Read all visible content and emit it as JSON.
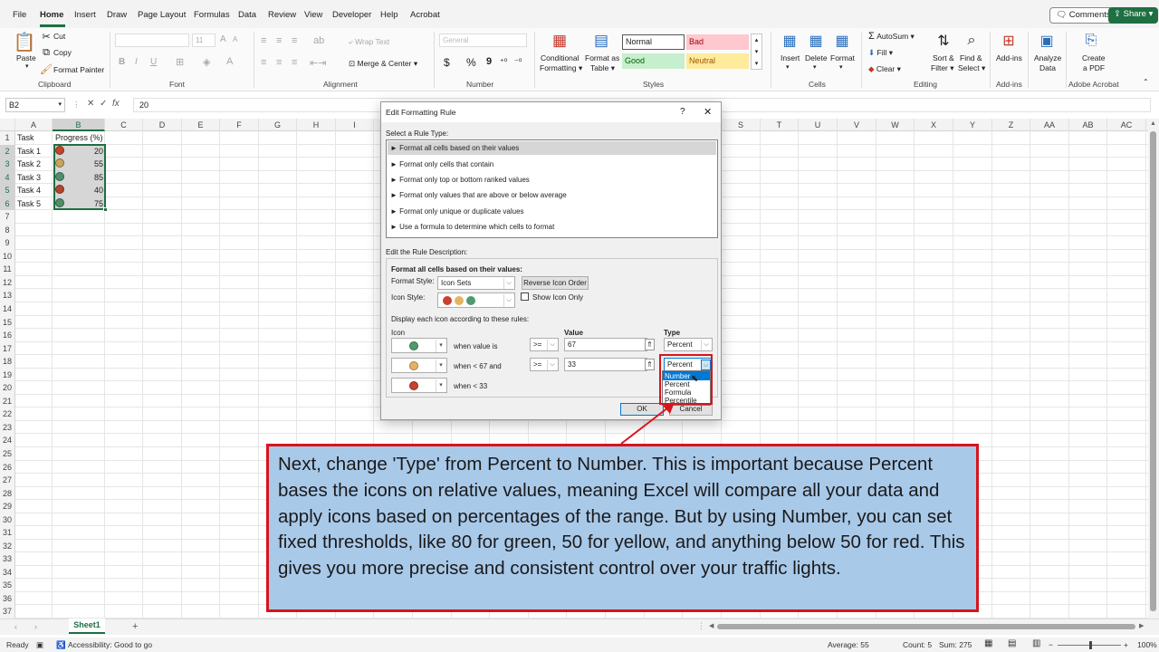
{
  "tabs": [
    "File",
    "Home",
    "Insert",
    "Draw",
    "Page Layout",
    "Formulas",
    "Data",
    "Review",
    "View",
    "Developer",
    "Help",
    "Acrobat"
  ],
  "top_buttons": {
    "comments": "Comments",
    "share": "Share"
  },
  "ribbon": {
    "clipboard": {
      "paste": "Paste",
      "cut": "Cut",
      "copy": "Copy",
      "format_painter": "Format Painter",
      "group": "Clipboard"
    },
    "font": {
      "font_name": "",
      "font_size": "11",
      "bold": "B",
      "italic": "I",
      "underline": "U",
      "group": "Font"
    },
    "alignment": {
      "wrap_text": "Wrap Text",
      "merge_center": "Merge & Center",
      "group": "Alignment"
    },
    "number": {
      "format": "General",
      "currency": "$",
      "percent": "%",
      "comma": "9",
      "group": "Number"
    },
    "styles": {
      "conditional": "Conditional",
      "formatting": "Formatting",
      "format_as": "Format as",
      "table": "Table",
      "normal": "Normal",
      "bad": "Bad",
      "good": "Good",
      "neutral": "Neutral",
      "group": "Styles"
    },
    "cells": {
      "insert": "Insert",
      "delete": "Delete",
      "format": "Format",
      "group": "Cells"
    },
    "editing": {
      "autosum": "AutoSum",
      "fill": "Fill",
      "clear": "Clear",
      "sort_filter": "Sort &",
      "filter": "Filter",
      "find_select": "Find &",
      "select": "Select",
      "group": "Editing"
    },
    "addins": {
      "addins": "Add-ins",
      "group": "Add-ins"
    },
    "analyze": {
      "l1": "Analyze",
      "l2": "Data"
    },
    "acrobat": {
      "l1": "Create",
      "l2": "a PDF",
      "group": "Adobe Acrobat"
    }
  },
  "formula_bar": {
    "name_box": "B2",
    "fx": "fx",
    "value": "20"
  },
  "columns": [
    "A",
    "B",
    "C",
    "D",
    "E",
    "F",
    "G",
    "H",
    "I",
    "J",
    "K",
    "L",
    "M",
    "N",
    "O",
    "P",
    "Q",
    "R",
    "S",
    "T",
    "U",
    "V",
    "W",
    "X",
    "Y",
    "Z",
    "AA",
    "AB",
    "AC"
  ],
  "rows": [
    "1",
    "2",
    "3",
    "4",
    "5",
    "6",
    "7",
    "8",
    "9",
    "10",
    "11",
    "12",
    "13",
    "14",
    "15",
    "16",
    "17",
    "18",
    "19",
    "20",
    "21",
    "22",
    "23",
    "24",
    "25",
    "26",
    "27",
    "28",
    "29",
    "30",
    "31",
    "32",
    "33",
    "34",
    "35",
    "36",
    "37"
  ],
  "sheet": {
    "header_a": "Task",
    "header_b": "Progress (%)",
    "tasks": [
      {
        "name": "Task 1",
        "value": "20",
        "color": "#c0452b"
      },
      {
        "name": "Task 2",
        "value": "55",
        "color": "#c9a45c"
      },
      {
        "name": "Task 3",
        "value": "85",
        "color": "#4f8f6b"
      },
      {
        "name": "Task 4",
        "value": "40",
        "color": "#b4452c"
      },
      {
        "name": "Task 5",
        "value": "75",
        "color": "#4f8f6b"
      }
    ]
  },
  "dialog": {
    "title": "Edit Formatting Rule",
    "help": "?",
    "close": "✕",
    "select_rule_type": "Select a Rule Type:",
    "rule_types": [
      "► Format all cells based on their values",
      "► Format only cells that contain",
      "► Format only top or bottom ranked values",
      "► Format only values that are above or below average",
      "► Format only unique or duplicate values",
      "► Use a formula to determine which cells to format"
    ],
    "edit_rule_desc": "Edit the Rule Description:",
    "format_all_cells": "Format all cells based on their values:",
    "format_style_label": "Format Style:",
    "format_style_value": "Icon Sets",
    "reverse_icon_order": "Reverse Icon Order",
    "icon_style_label": "Icon Style:",
    "show_icon_only": "Show Icon Only",
    "display_rules": "Display each icon according to these rules:",
    "col_icon": "Icon",
    "col_value": "Value",
    "col_type": "Type",
    "rows": [
      {
        "when": "when value is",
        "op": ">=",
        "value": "67",
        "type": "Percent",
        "color": "#4f9a6e"
      },
      {
        "when": "when < 67 and",
        "op": ">=",
        "value": "33",
        "type": "Percent",
        "color": "#e6b461"
      },
      {
        "when": "when < 33",
        "op": "",
        "value": "",
        "type": "",
        "color": "#c9412f"
      }
    ],
    "type_options": [
      "Number",
      "Percent",
      "Formula",
      "Percentile"
    ],
    "ok": "OK",
    "cancel": "Cancel"
  },
  "callout_text": "Next, change 'Type' from Percent to Number. This is important because Percent bases the icons on relative values, meaning Excel will compare all your data and apply icons based on percentages of the range. But by using Number, you can set fixed thresholds, like 80 for green, 50 for yellow, and anything below 50 for red. This gives you more precise and consistent control over your traffic lights.",
  "sheet_tab": "Sheet1",
  "status": {
    "ready": "Ready",
    "accessibility": "Accessibility: Good to go",
    "average": "Average: 55",
    "count": "Count: 5",
    "sum": "Sum: 275",
    "zoom": "100%"
  },
  "colors": {
    "accent": "#1e6f42",
    "callout_bg": "#a9c9e9",
    "callout_border": "#d8141c",
    "selection": "#1e6f42"
  }
}
